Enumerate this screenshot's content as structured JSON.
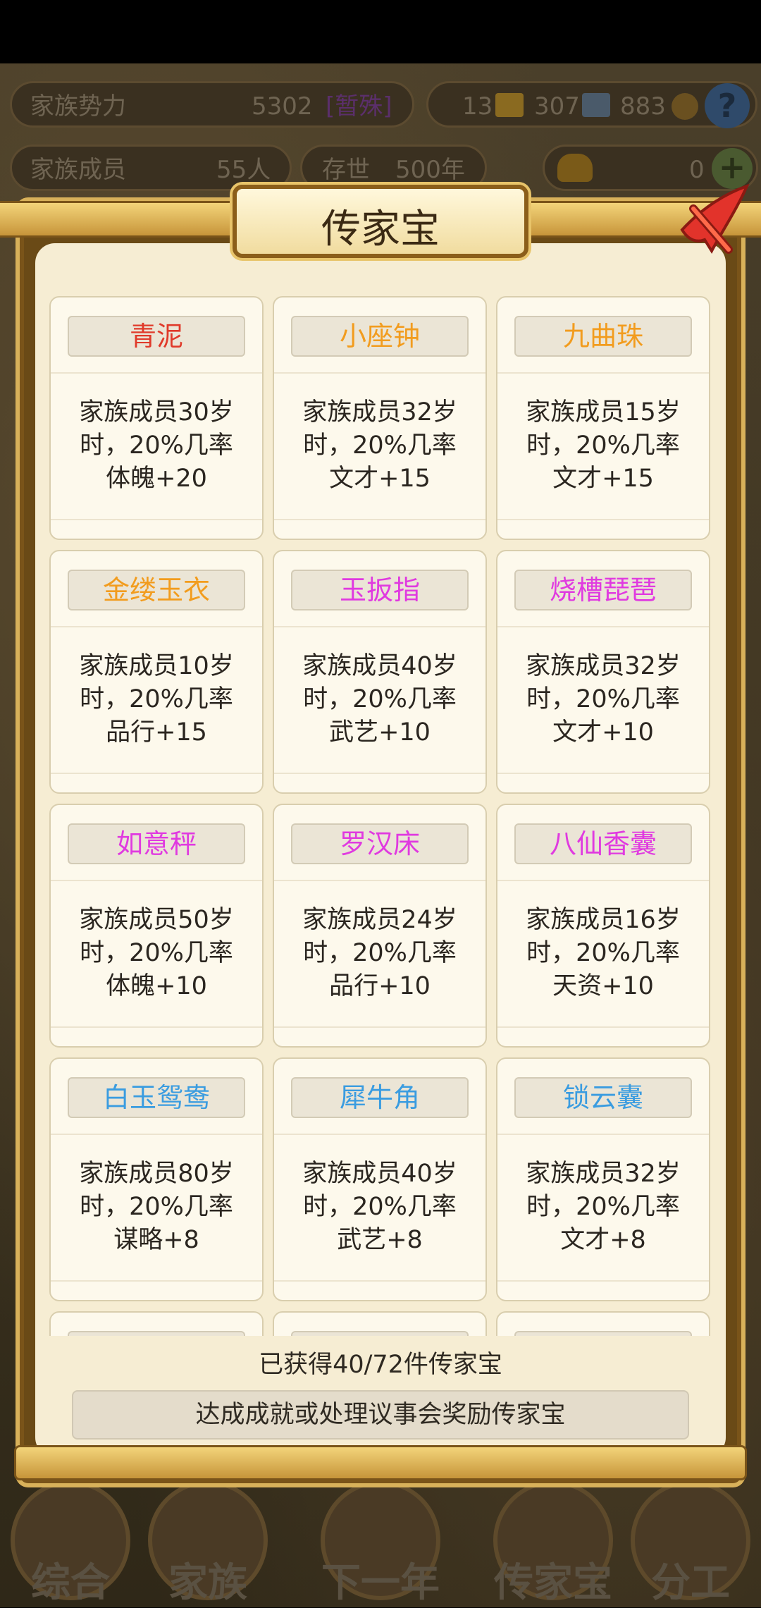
{
  "hud": {
    "power_label": "家族势力",
    "power_value": "5302",
    "power_rank": "[暂殊]",
    "resources": [
      "13",
      "307",
      "883"
    ],
    "members_label": "家族成员",
    "members_value": "55人",
    "age_label": "存世",
    "age_value": "500年",
    "gold_value": "0",
    "help": "?",
    "plus": "+"
  },
  "modal": {
    "title": "传家宝",
    "items": [
      {
        "name": "青泥",
        "color": "#e03a2a",
        "l1": "家族成员30岁",
        "l2": "时，20%几率",
        "l3": "体魄+20"
      },
      {
        "name": "小座钟",
        "color": "#f29c1e",
        "l1": "家族成员32岁",
        "l2": "时，20%几率",
        "l3": "文才+15"
      },
      {
        "name": "九曲珠",
        "color": "#f29c1e",
        "l1": "家族成员15岁",
        "l2": "时，20%几率",
        "l3": "文才+15"
      },
      {
        "name": "金缕玉衣",
        "color": "#f29c1e",
        "l1": "家族成员10岁",
        "l2": "时，20%几率",
        "l3": "品行+15"
      },
      {
        "name": "玉扳指",
        "color": "#e03ae0",
        "l1": "家族成员40岁",
        "l2": "时，20%几率",
        "l3": "武艺+10"
      },
      {
        "name": "烧槽琵琶",
        "color": "#e03ae0",
        "l1": "家族成员32岁",
        "l2": "时，20%几率",
        "l3": "文才+10"
      },
      {
        "name": "如意秤",
        "color": "#e03ae0",
        "l1": "家族成员50岁",
        "l2": "时，20%几率",
        "l3": "体魄+10"
      },
      {
        "name": "罗汉床",
        "color": "#e03ae0",
        "l1": "家族成员24岁",
        "l2": "时，20%几率",
        "l3": "品行+10"
      },
      {
        "name": "八仙香囊",
        "color": "#e03ae0",
        "l1": "家族成员16岁",
        "l2": "时，20%几率",
        "l3": "天资+10"
      },
      {
        "name": "白玉鸳鸯",
        "color": "#3a9ce0",
        "l1": "家族成员80岁",
        "l2": "时，20%几率",
        "l3": "谋略+8"
      },
      {
        "name": "犀牛角",
        "color": "#3a9ce0",
        "l1": "家族成员40岁",
        "l2": "时，20%几率",
        "l3": "武艺+8"
      },
      {
        "name": "锁云囊",
        "color": "#3a9ce0",
        "l1": "家族成员32岁",
        "l2": "时，20%几率",
        "l3": "文才+8"
      },
      {
        "name": "",
        "color": "#3a9ce0",
        "l1": "",
        "l2": "",
        "l3": ""
      },
      {
        "name": "",
        "color": "#3a9ce0",
        "l1": "",
        "l2": "",
        "l3": ""
      },
      {
        "name": "",
        "color": "#3a9ce0",
        "l1": "",
        "l2": "",
        "l3": ""
      }
    ],
    "count_text": "已获得40/72件传家宝",
    "hint_text": "达成成就或处理议事会奖励传家宝"
  },
  "nav": [
    "综合",
    "家族",
    "下一年",
    "传家宝",
    "分工"
  ]
}
